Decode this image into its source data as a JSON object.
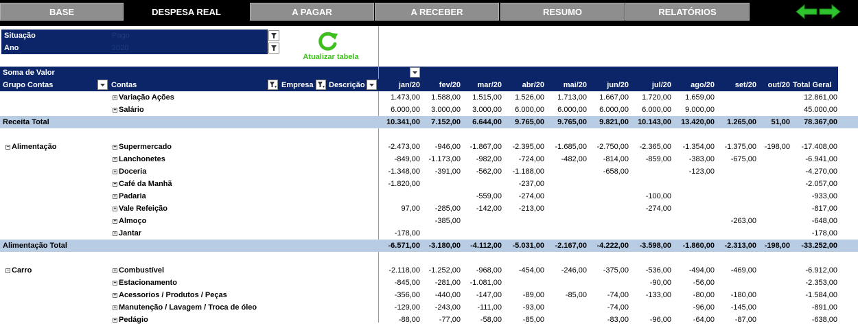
{
  "tabs": [
    "BASE",
    "DESPESA REAL",
    "A PAGAR",
    "A RECEBER",
    "RESUMO",
    "RELATÓRIOS"
  ],
  "active_tab": "DESPESA REAL",
  "filters": {
    "situacao_label": "Situação",
    "situacao_value": "Pago",
    "ano_label": "Ano",
    "ano_value": "2020"
  },
  "refresh_label": "Atualizar tabela",
  "pivot": {
    "values_label": "Soma de Valor",
    "row_headers": [
      "Grupo Contas",
      "Contas",
      "Empresa",
      "Descrição"
    ],
    "months": [
      "jan/20",
      "fev/20",
      "mar/20",
      "abr/20",
      "mai/20",
      "jun/20",
      "jul/20",
      "ago/20",
      "set/20",
      "out/20"
    ],
    "total_header": "Total Geral"
  },
  "rows": [
    {
      "type": "item",
      "group": "",
      "conta": "Variação Ações",
      "values": [
        "1.473,00",
        "1.588,00",
        "1.515,00",
        "1.526,00",
        "1.713,00",
        "1.667,00",
        "1.720,00",
        "1.659,00",
        "",
        ""
      ],
      "total": "12.861,00"
    },
    {
      "type": "item",
      "group": "",
      "conta": "Salário",
      "values": [
        "6.000,00",
        "3.000,00",
        "3.000,00",
        "6.000,00",
        "6.000,00",
        "6.000,00",
        "6.000,00",
        "9.000,00",
        "",
        ""
      ],
      "total": "45.000,00"
    },
    {
      "type": "total",
      "group": "Receita Total",
      "conta": "",
      "values": [
        "10.341,00",
        "7.152,00",
        "6.644,00",
        "9.765,00",
        "9.765,00",
        "9.821,00",
        "10.143,00",
        "13.420,00",
        "1.265,00",
        "51,00"
      ],
      "total": "78.367,00"
    },
    {
      "type": "blank"
    },
    {
      "type": "item",
      "group": "Alimentação",
      "conta": "Supermercado",
      "values": [
        "-2.473,00",
        "-946,00",
        "-1.867,00",
        "-2.395,00",
        "-1.685,00",
        "-2.750,00",
        "-2.365,00",
        "-1.354,00",
        "-1.375,00",
        "-198,00"
      ],
      "total": "-17.408,00"
    },
    {
      "type": "item",
      "group": "",
      "conta": "Lanchonetes",
      "values": [
        "-849,00",
        "-1.173,00",
        "-982,00",
        "-724,00",
        "-482,00",
        "-814,00",
        "-859,00",
        "-383,00",
        "-675,00",
        ""
      ],
      "total": "-6.941,00"
    },
    {
      "type": "item",
      "group": "",
      "conta": "Doceria",
      "values": [
        "-1.348,00",
        "-391,00",
        "-562,00",
        "-1.188,00",
        "",
        "-658,00",
        "",
        "-123,00",
        "",
        ""
      ],
      "total": "-4.270,00"
    },
    {
      "type": "item",
      "group": "",
      "conta": "Café da Manhã",
      "values": [
        "-1.820,00",
        "",
        "",
        "-237,00",
        "",
        "",
        "",
        "",
        "",
        ""
      ],
      "total": "-2.057,00"
    },
    {
      "type": "item",
      "group": "",
      "conta": "Padaria",
      "values": [
        "",
        "",
        "-559,00",
        "-274,00",
        "",
        "",
        "-100,00",
        "",
        "",
        ""
      ],
      "total": "-933,00"
    },
    {
      "type": "item",
      "group": "",
      "conta": "Vale Refeição",
      "values": [
        "97,00",
        "-285,00",
        "-142,00",
        "-213,00",
        "",
        "",
        "-274,00",
        "",
        "",
        ""
      ],
      "total": "-817,00"
    },
    {
      "type": "item",
      "group": "",
      "conta": "Almoço",
      "values": [
        "",
        "-385,00",
        "",
        "",
        "",
        "",
        "",
        "",
        "-263,00",
        ""
      ],
      "total": "-648,00"
    },
    {
      "type": "item",
      "group": "",
      "conta": "Jantar",
      "values": [
        "-178,00",
        "",
        "",
        "",
        "",
        "",
        "",
        "",
        "",
        ""
      ],
      "total": "-178,00"
    },
    {
      "type": "total",
      "group": "Alimentação Total",
      "conta": "",
      "values": [
        "-6.571,00",
        "-3.180,00",
        "-4.112,00",
        "-5.031,00",
        "-2.167,00",
        "-4.222,00",
        "-3.598,00",
        "-1.860,00",
        "-2.313,00",
        "-198,00"
      ],
      "total": "-33.252,00"
    },
    {
      "type": "blank"
    },
    {
      "type": "item",
      "group": "Carro",
      "conta": "Combustível",
      "values": [
        "-2.118,00",
        "-1.252,00",
        "-968,00",
        "-454,00",
        "-246,00",
        "-375,00",
        "-536,00",
        "-494,00",
        "-469,00",
        ""
      ],
      "total": "-6.912,00"
    },
    {
      "type": "item",
      "group": "",
      "conta": "Estacionamento",
      "values": [
        "-845,00",
        "-281,00",
        "-1.081,00",
        "",
        "",
        "",
        "-90,00",
        "-56,00",
        "",
        ""
      ],
      "total": "-2.353,00"
    },
    {
      "type": "item",
      "group": "",
      "conta": "Acessorios / Produtos / Peças",
      "values": [
        "-356,00",
        "-440,00",
        "-147,00",
        "-89,00",
        "-85,00",
        "-74,00",
        "-133,00",
        "-80,00",
        "-180,00",
        ""
      ],
      "total": "-1.584,00"
    },
    {
      "type": "item",
      "group": "",
      "conta": "Manutenção / Lavagem / Troca de óleo",
      "values": [
        "-129,00",
        "-243,00",
        "-111,00",
        "-93,00",
        "",
        "-74,00",
        "",
        "-96,00",
        "-145,00",
        ""
      ],
      "total": "-891,00"
    },
    {
      "type": "item",
      "group": "",
      "conta": "Pedágio",
      "values": [
        "-88,00",
        "-77,00",
        "-58,00",
        "-85,00",
        "",
        "-83,00",
        "-96,00",
        "-64,00",
        "-87,00",
        ""
      ],
      "total": "-638,00"
    }
  ],
  "colors": {
    "header_bg": "#0b2568",
    "subtotal_bg": "#b8cce4",
    "tab_bg": "#8e8e8e",
    "refresh_green": "#3fbf1f"
  }
}
